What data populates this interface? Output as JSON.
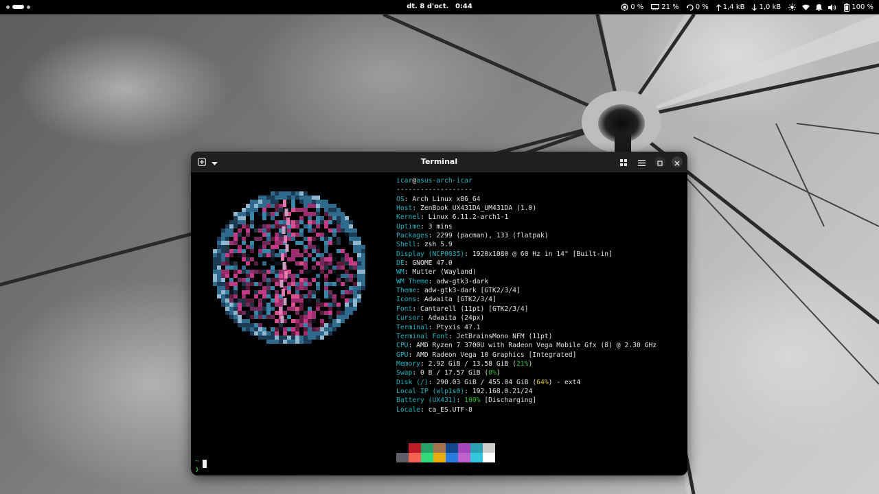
{
  "topbar": {
    "date": "dt. 8 d'oct.",
    "time": "0:44",
    "cpu": "0 %",
    "memory": "21 %",
    "swap": "0 %",
    "upload": "1,4 kB",
    "download": "1,0 kB",
    "battery": "100 %",
    "icons": [
      "cpu-icon",
      "memory-icon",
      "swap-icon",
      "upload-arrow-icon",
      "download-arrow-icon",
      "brightness-icon",
      "wifi-icon",
      "notification-icon",
      "volume-icon",
      "battery-icon"
    ]
  },
  "window": {
    "title": "Terminal",
    "buttons": [
      "new-tab-icon",
      "dropdown-icon",
      "tab-overview-icon",
      "menu-icon",
      "maximize-icon",
      "close-icon"
    ]
  },
  "fastfetch": {
    "user": "icar",
    "at": "@",
    "host": "asus-arch-icar",
    "separator": "-------------------",
    "rows": [
      {
        "key": "OS",
        "value": ": Arch Linux x86_64"
      },
      {
        "key": "Host",
        "value": ": ZenBook UX431DA_UM431DA (1.0)"
      },
      {
        "key": "Kernel",
        "value": ": Linux 6.11.2-arch1-1"
      },
      {
        "key": "Uptime",
        "value": ": 3 mins"
      },
      {
        "key": "Packages",
        "value": ": 2299 (pacman), 133 (flatpak)"
      },
      {
        "key": "Shell",
        "value": ": zsh 5.9"
      },
      {
        "key": "Display (NCP0035)",
        "value": ": 1920x1080 @ 60 Hz in 14\" [Built-in]"
      },
      {
        "key": "DE",
        "value": ": GNOME 47.0"
      },
      {
        "key": "WM",
        "value": ": Mutter (Wayland)"
      },
      {
        "key": "WM Theme",
        "value": ": adw-gtk3-dark"
      },
      {
        "key": "Theme",
        "value": ": adw-gtk3-dark [GTK2/3/4]"
      },
      {
        "key": "Icons",
        "value": ": Adwaita [GTK2/3/4]"
      },
      {
        "key": "Font",
        "value": ": Cantarell (11pt) [GTK2/3/4]"
      },
      {
        "key": "Cursor",
        "value": ": Adwaita (24px)"
      },
      {
        "key": "Terminal",
        "value": ": Ptyxis 47.1"
      },
      {
        "key": "Terminal Font",
        "value": ": JetBrainsMono NFM (11pt)"
      },
      {
        "key": "CPU",
        "value": ": AMD Ryzen 7 3700U with Radeon Vega Mobile Gfx (8) @ 2.30 GHz"
      },
      {
        "key": "GPU",
        "value": ": AMD Radeon Vega 10 Graphics [Integrated]"
      }
    ],
    "memory": {
      "key": "Memory",
      "pre": ": 2.92 GiB / 13.58 GiB (",
      "pct": "21%",
      "post": ")"
    },
    "swap": {
      "key": "Swap",
      "pre": ": 0 B / 17.57 GiB (",
      "pct": "0%",
      "post": ")"
    },
    "disk": {
      "key": "Disk (/)",
      "pre": ": 290.03 GiB / 455.04 GiB (",
      "pct": "64%",
      "post": ") - ext4"
    },
    "localip": {
      "key": "Local IP (wlp1s0)",
      "value": ": 192.168.0.21/24"
    },
    "battery": {
      "key": "Battery (UX431)",
      "pre": ": ",
      "pct": "100%",
      "post": " [Discharging]"
    },
    "locale": {
      "key": "Locale",
      "value": ": ca_ES.UTF-8"
    },
    "palette_top": [
      "#000000",
      "#c01c28",
      "#26a269",
      "#a2734c",
      "#12488b",
      "#a347ba",
      "#2aa1b3",
      "#d0cfcc"
    ],
    "palette_bottom": [
      "#5e5c64",
      "#f66151",
      "#33da7a",
      "#e9ad0c",
      "#2a7bde",
      "#c061cb",
      "#33c7de",
      "#ffffff"
    ]
  },
  "prompt": {
    "dir": "~",
    "symbol": "❯"
  }
}
